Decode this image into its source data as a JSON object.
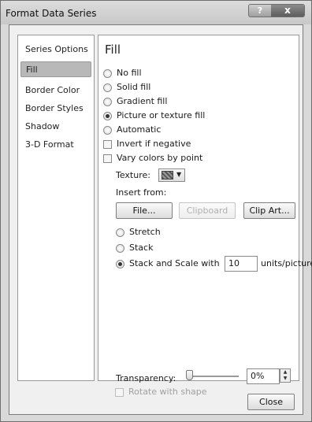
{
  "window": {
    "title": "Format Data Series",
    "help_label": "?",
    "close_label": "x"
  },
  "sidebar": {
    "items": [
      {
        "label": "Series Options"
      },
      {
        "label": "Fill",
        "selected": true
      },
      {
        "label": "Border Color"
      },
      {
        "label": "Border Styles"
      },
      {
        "label": "Shadow"
      },
      {
        "label": "3-D Format"
      }
    ]
  },
  "fill": {
    "heading": "Fill",
    "options": {
      "no_fill": "No fill",
      "solid_fill": "Solid fill",
      "gradient_fill": "Gradient fill",
      "picture_fill": "Picture or texture fill",
      "automatic": "Automatic"
    },
    "selected_option": "picture_fill",
    "invert_if_negative": "Invert if negative",
    "vary_colors": "Vary colors by point",
    "texture_label": "Texture:",
    "texture_icon": "texture-swatch-icon",
    "insert_from": "Insert from:",
    "buttons": {
      "file": "File...",
      "clipboard": "Clipboard",
      "clip_art": "Clip Art..."
    },
    "stretch": "Stretch",
    "stack": "Stack",
    "stack_scale": "Stack and Scale with",
    "stack_scale_value": "10",
    "units_label": "units/picture",
    "transparency_label": "Transparency:",
    "transparency_value": "0%",
    "rotate_with_shape": "Rotate with shape"
  },
  "footer": {
    "close_label": "Close"
  }
}
